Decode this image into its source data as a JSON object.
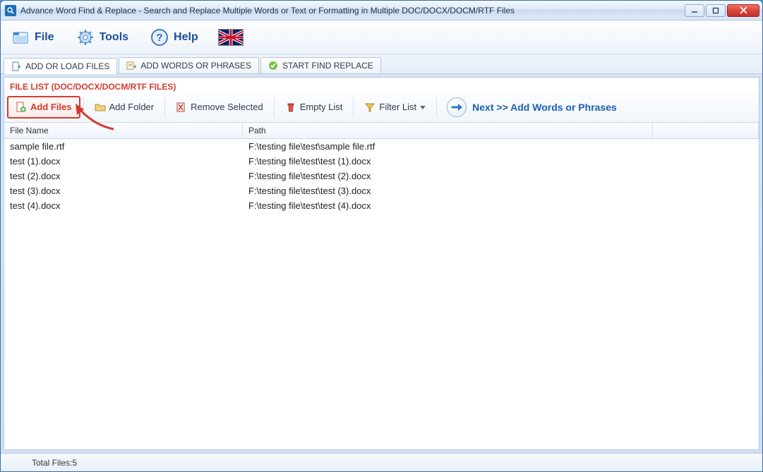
{
  "window": {
    "title": "Advance Word Find & Replace - Search and Replace Multiple Words or Text  or Formatting in Multiple DOC/DOCX/DOCM/RTF Files"
  },
  "menu": {
    "file": "File",
    "tools": "Tools",
    "help": "Help"
  },
  "tabs": {
    "t1": "ADD OR LOAD FILES",
    "t2": "ADD WORDS OR PHRASES",
    "t3": "START FIND REPLACE"
  },
  "section": {
    "title": "FILE LIST (DOC/DOCX/DOCM/RTF FILES)"
  },
  "toolbar": {
    "add_files": "Add Files",
    "add_folder": "Add Folder",
    "remove_selected": "Remove Selected",
    "empty_list": "Empty List",
    "filter_list": "Filter List",
    "next_prefix": "Next >>",
    "next_rest": "Add Words or Phrases"
  },
  "table": {
    "headers": {
      "name": "File Name",
      "path": "Path"
    },
    "rows": [
      {
        "name": "sample file.rtf",
        "path": "F:\\testing file\\test\\sample file.rtf"
      },
      {
        "name": "test (1).docx",
        "path": "F:\\testing file\\test\\test (1).docx"
      },
      {
        "name": "test (2).docx",
        "path": "F:\\testing file\\test\\test (2).docx"
      },
      {
        "name": "test (3).docx",
        "path": "F:\\testing file\\test\\test (3).docx"
      },
      {
        "name": "test (4).docx",
        "path": "F:\\testing file\\test\\test (4).docx"
      }
    ]
  },
  "status": {
    "total_files_label": "Total Files:",
    "total_files_count": "5"
  }
}
